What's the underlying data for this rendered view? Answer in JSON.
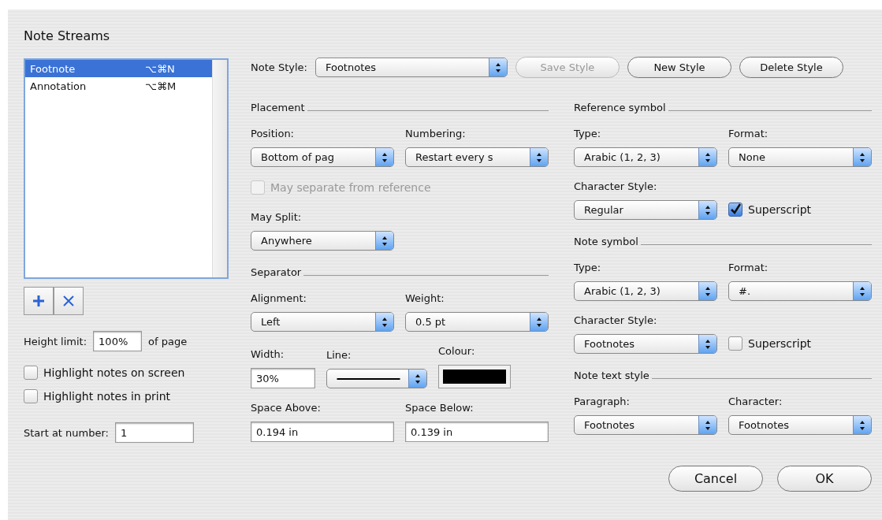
{
  "window": {
    "title": "Note Streams"
  },
  "streams": [
    {
      "name": "Footnote",
      "shortcut": "⌥⌘N",
      "selected": true
    },
    {
      "name": "Annotation",
      "shortcut": "⌥⌘M",
      "selected": false
    }
  ],
  "height_limit": {
    "label": "Height limit:",
    "value": "100%",
    "suffix": "of page"
  },
  "options": [
    {
      "label": "Highlight notes on screen",
      "checked": false
    },
    {
      "label": "Highlight notes in print",
      "checked": false
    }
  ],
  "start_at": {
    "label": "Start at number:",
    "value": "1"
  },
  "note_style": {
    "label": "Note Style:",
    "value": "Footnotes"
  },
  "style_buttons": [
    {
      "label": "Save Style",
      "disabled": true
    },
    {
      "label": "New Style",
      "disabled": false
    },
    {
      "label": "Delete Style",
      "disabled": false
    }
  ],
  "left_sections": [
    {
      "heading": "Placement",
      "rows": [
        [
          {
            "kind": "popup",
            "label": "Position:",
            "value": "Bottom of pag"
          },
          {
            "kind": "popup",
            "label": "Numbering:",
            "value": "Restart every s"
          }
        ],
        [
          {
            "kind": "checkbox",
            "label": "May separate from reference",
            "checked": false,
            "disabled": true
          }
        ],
        [
          {
            "kind": "popup",
            "label": "May Split:",
            "value": "Anywhere"
          }
        ]
      ]
    },
    {
      "heading": "Separator",
      "rows": [
        [
          {
            "kind": "popup",
            "label": "Alignment:",
            "value": "Left"
          },
          {
            "kind": "popup",
            "label": "Weight:",
            "value": "0.5 pt"
          }
        ],
        [
          {
            "kind": "input",
            "label": "Width:",
            "value": "30%"
          },
          {
            "kind": "line",
            "label": "Line:"
          },
          {
            "kind": "swatch",
            "label": "Colour:"
          }
        ],
        [
          {
            "kind": "input",
            "label": "Space Above:",
            "value": "0.194 in"
          },
          {
            "kind": "input",
            "label": "Space Below:",
            "value": "0.139 in"
          }
        ]
      ]
    }
  ],
  "right_sections": [
    {
      "heading": "Reference symbol",
      "rows": [
        [
          {
            "kind": "popup",
            "label": "Type:",
            "value": "Arabic (1, 2, 3)"
          },
          {
            "kind": "popup",
            "label": "Format:",
            "value": "None"
          }
        ],
        [
          {
            "kind": "popup",
            "label": "Character Style:",
            "value": "Regular"
          },
          {
            "kind": "checkbox",
            "label": "Superscript",
            "checked": true,
            "disabled": false
          }
        ]
      ]
    },
    {
      "heading": "Note symbol",
      "rows": [
        [
          {
            "kind": "popup",
            "label": "Type:",
            "value": "Arabic (1, 2, 3)"
          },
          {
            "kind": "popup",
            "label": "Format:",
            "value": "#."
          }
        ],
        [
          {
            "kind": "popup",
            "label": "Character Style:",
            "value": "Footnotes"
          },
          {
            "kind": "checkbox",
            "label": "Superscript",
            "checked": false,
            "disabled": false
          }
        ]
      ]
    },
    {
      "heading": "Note text style",
      "rows": [
        [
          {
            "kind": "popup",
            "label": "Paragraph:",
            "value": "Footnotes"
          },
          {
            "kind": "popup",
            "label": "Character:",
            "value": "Footnotes"
          }
        ]
      ]
    }
  ],
  "buttons": [
    "Cancel",
    "OK"
  ]
}
